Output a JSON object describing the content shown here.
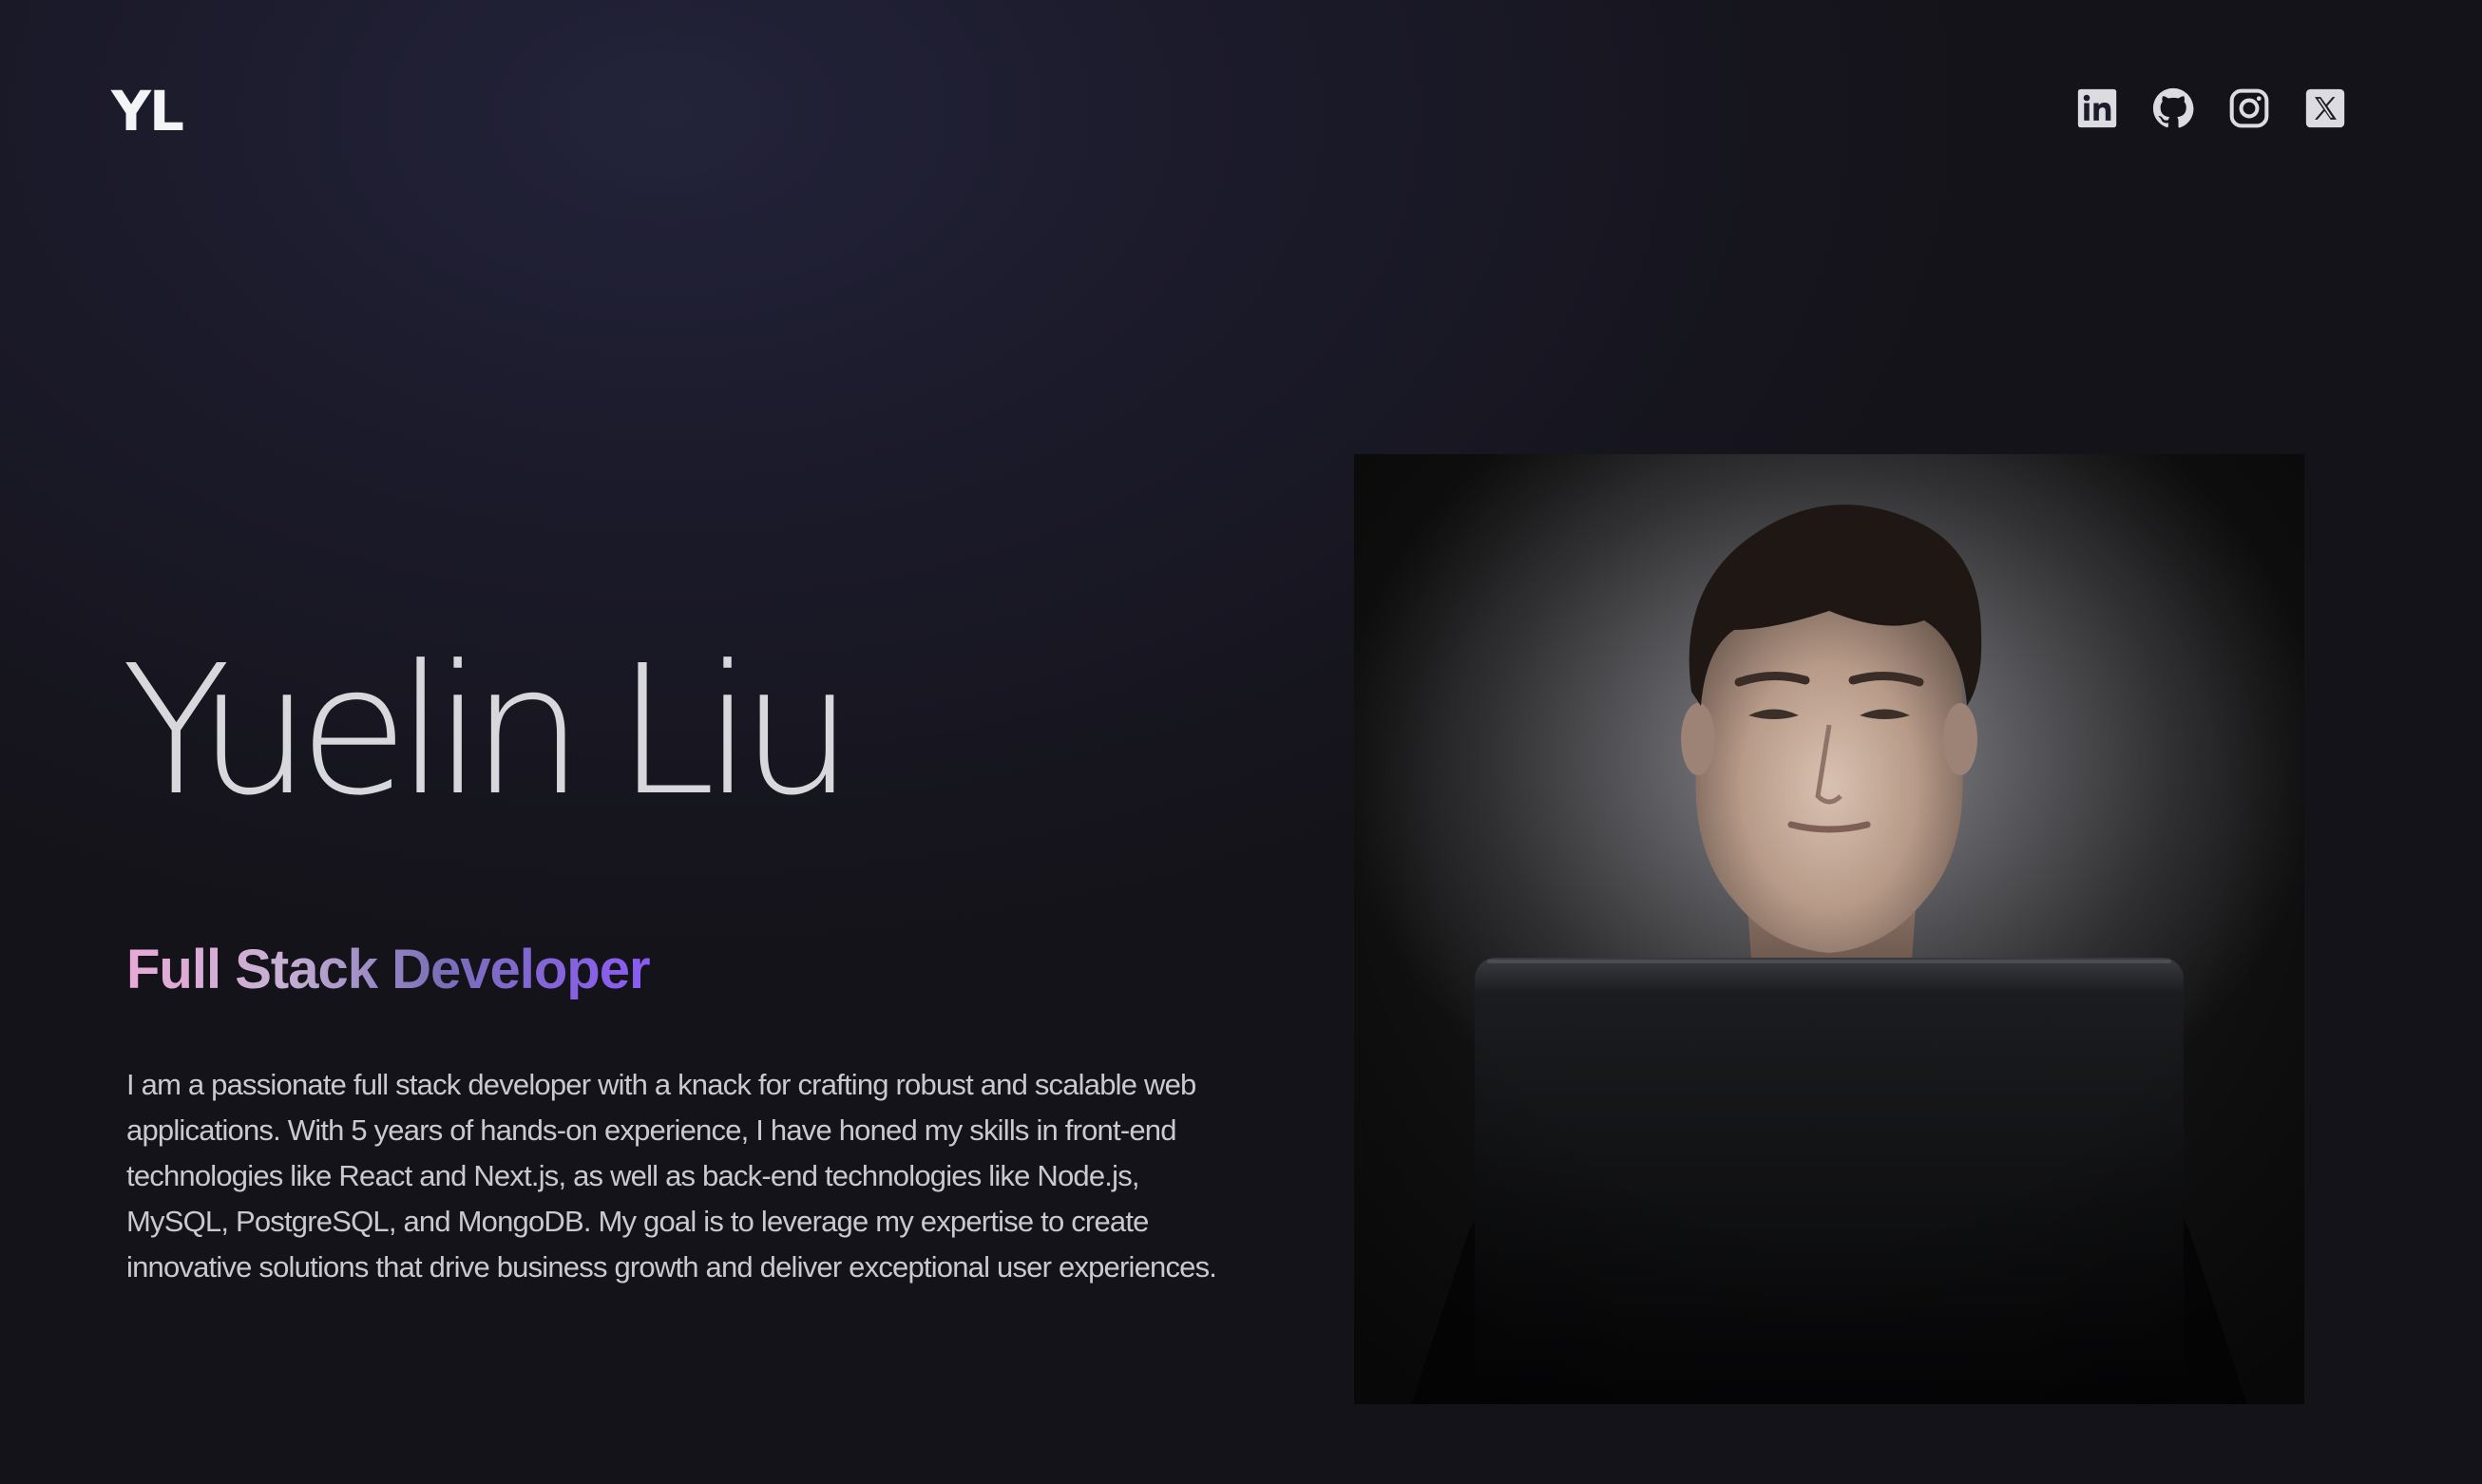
{
  "header": {
    "logo_text": "YL",
    "social_links": [
      {
        "name": "LinkedIn",
        "icon": "linkedin-icon"
      },
      {
        "name": "GitHub",
        "icon": "github-icon"
      },
      {
        "name": "Instagram",
        "icon": "instagram-icon"
      },
      {
        "name": "X",
        "icon": "x-icon"
      }
    ]
  },
  "hero": {
    "name": "Yuelin Liu",
    "role": "Full Stack Developer",
    "role_gradient": [
      "#e9a9d6",
      "#c7b0d4",
      "#7a6fb8",
      "#8b5cf6"
    ],
    "bio": "I am a passionate full stack developer with a knack for crafting robust and scalable web applications. With 5 years of hands-on experience, I have honed my skills in front-end technologies like React and Next.js, as well as back-end technologies like Node.js, MySQL, PostgreSQL, and MongoDB. My goal is to leverage my expertise to create innovative solutions that drive business growth and deliver exceptional user experiences."
  },
  "portrait": {
    "icon": "portrait-photo"
  },
  "colors": {
    "background": "#1b1a2a",
    "text": "#d7d7dc",
    "icon": "#dcdce0"
  }
}
